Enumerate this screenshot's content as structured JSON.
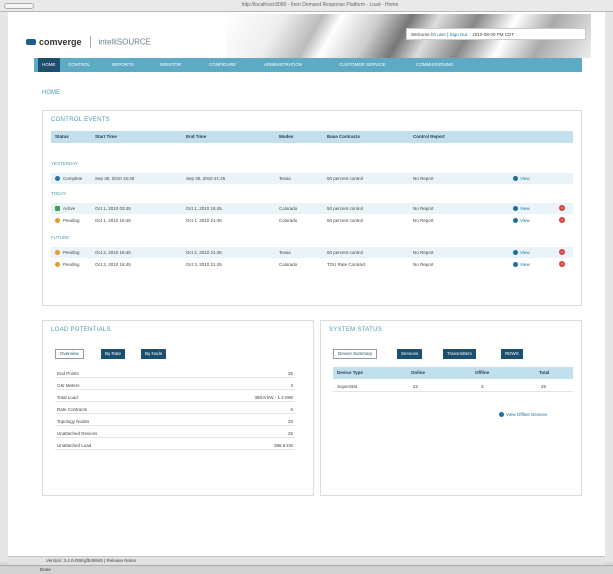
{
  "window": {
    "title": "http://localhost:8080 - Itron Demand Response Platform - Load - Home"
  },
  "header": {
    "brand": "comverge",
    "product": "intelliSOURCE",
    "welcome_prefix": "Welcome",
    "welcome_user": "bh user",
    "sign_out": "Sign Out",
    "datetime": "2010-08-09 PM CDT"
  },
  "nav": {
    "items": [
      "HOME",
      "CONTROL",
      "REPORTS",
      "MONITOR",
      "CONFIGURE",
      "ADMINISTRATION",
      "CUSTOMER SERVICE",
      "COMMISSIONING"
    ]
  },
  "page": {
    "title": "HOME"
  },
  "control_events": {
    "title": "CONTROL EVENTS",
    "columns": [
      "Status",
      "Start Time",
      "End Time",
      "Modes",
      "Base Contracts",
      "Control Report"
    ],
    "groups": [
      {
        "label": "YESTERDAY",
        "rows": [
          {
            "status": "Complete",
            "start": "Sep 30, 2010 15:45",
            "end": "Sep 30, 2010 21:45",
            "mode": "Texas",
            "contract": "50 percent control",
            "report": "No Report",
            "view": "View",
            "cancel": false,
            "icon": "check-icon"
          }
        ]
      },
      {
        "label": "TODAY",
        "rows": [
          {
            "status": "Active",
            "start": "Oct 1, 2010 03:45",
            "end": "Oct 1, 2010 18:45",
            "mode": "Colorado",
            "contract": "50 percent control",
            "report": "No Report",
            "view": "View",
            "cancel": true,
            "icon": "active-icon"
          },
          {
            "status": "Pending",
            "start": "Oct 1, 2010 16:45",
            "end": "Oct 1, 2010 21:45",
            "mode": "Colorado",
            "contract": "50 percent control",
            "report": "No Report",
            "view": "View",
            "cancel": true,
            "icon": "pending-icon"
          }
        ]
      },
      {
        "label": "FUTURE",
        "rows": [
          {
            "status": "Pending",
            "start": "Oct 2, 2010 16:45",
            "end": "Oct 2, 2010 21:45",
            "mode": "Texas",
            "contract": "50 percent control",
            "report": "No Report",
            "view": "View",
            "cancel": true,
            "icon": "pending-icon"
          },
          {
            "status": "Pending",
            "start": "Oct 3, 2010 16:45",
            "end": "Oct 3, 2010 21:45",
            "mode": "Colorado",
            "contract": "TOU Rate Contract",
            "report": "No Report",
            "view": "View",
            "cancel": true,
            "icon": "pending-icon"
          }
        ]
      }
    ]
  },
  "load_potentials": {
    "title": "LOAD POTENTIALS",
    "tabs": [
      "Overview",
      "By Rate",
      "By Node"
    ],
    "rows": [
      {
        "k": "End Points",
        "v": "25"
      },
      {
        "k": "C&I Meters",
        "v": "3"
      },
      {
        "k": "Total Load",
        "v": "388.8 kW - 1.2 MW"
      },
      {
        "k": "Rate Contracts",
        "v": "6"
      },
      {
        "k": "Topology Nodes",
        "v": "20"
      },
      {
        "k": "Unattached Devices",
        "v": "25"
      },
      {
        "k": "Unattached Load",
        "v": "388.8 kW"
      }
    ]
  },
  "system_status": {
    "title": "SYSTEM STATUS",
    "tabs": [
      "Device Summary",
      "Services",
      "Transmitters",
      "RDWS"
    ],
    "columns": [
      "Device Type",
      "Online",
      "Offline",
      "Total"
    ],
    "rows": [
      {
        "type": "SuperStat",
        "online": "22",
        "offline": "3",
        "total": "25"
      }
    ],
    "link": "View Offline Devices"
  },
  "footer": {
    "version": "Version: 3.4.0-008rgfb49949 | Release Notes"
  },
  "statusbar": {
    "text": "Done"
  }
}
